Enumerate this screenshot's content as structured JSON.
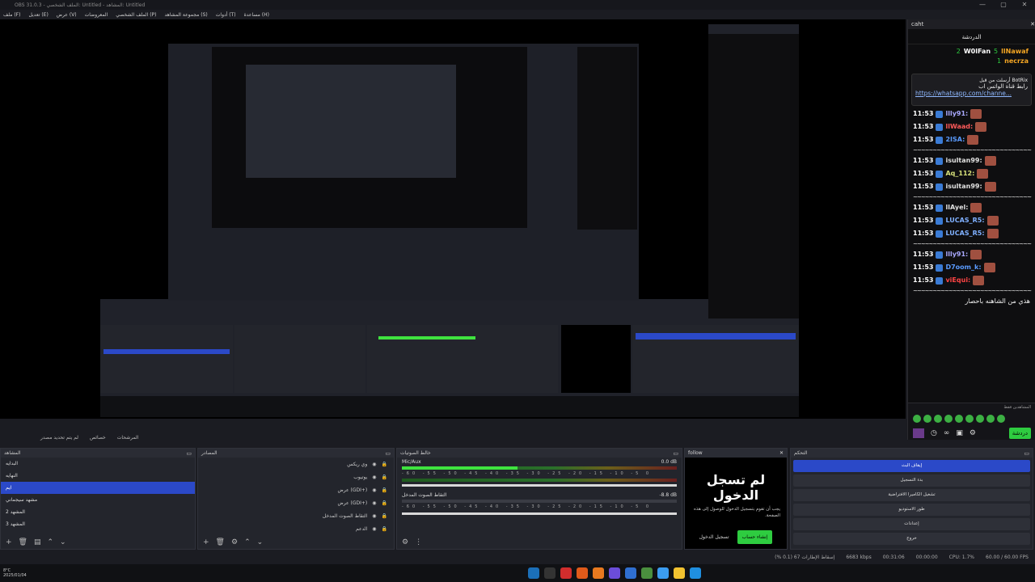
{
  "window": {
    "title": "OBS 31.0.3 - الملف الشخصي: Untitled - المشاهد: Untitled",
    "controls": [
      "—",
      "▢",
      "✕"
    ]
  },
  "menu": [
    "ملف (F)",
    "تعديل (E)",
    "عرض (V)",
    "المعروضات",
    "الملف الشخصي (P)",
    "مجموعة المشاهد (S)",
    "أدوات (T)",
    "مساعدة (H)"
  ],
  "chat": {
    "header": "caht",
    "title": "الدردشة",
    "leaders": [
      {
        "name": "llNawaf",
        "count": "5"
      },
      {
        "name": "W0lFan",
        "count": "2"
      },
      {
        "name": "necrza",
        "count": "1"
      }
    ],
    "pinned_by": "أرسلت من قبل BotRix",
    "pinned_text": "رابط قناة الواتس اب",
    "pinned_link": "https://whatsapp.com/channe...",
    "messages": [
      {
        "time": "11:53",
        "user": "llly91:",
        "color": "#a9a9ff"
      },
      {
        "time": "11:53",
        "user": "llWaad:",
        "color": "#ff5a5a"
      },
      {
        "time": "11:53",
        "user": "2ISA:",
        "color": "#5a9bff"
      },
      {
        "time": "11:53",
        "user": "isultan99:",
        "color": "#e0e0e0"
      },
      {
        "time": "11:53",
        "user": "Aq_112:",
        "color": "#d6e07a"
      },
      {
        "time": "11:53",
        "user": "isultan99:",
        "color": "#e0e0e0"
      },
      {
        "time": "11:53",
        "user": "llAyel:",
        "color": "#e0e0e0"
      },
      {
        "time": "11:53",
        "user": "LUCAS_R5:",
        "color": "#7fb0ff"
      },
      {
        "time": "11:53",
        "user": "LUCAS_R5:",
        "color": "#7fb0ff"
      },
      {
        "time": "11:53",
        "user": "llly91:",
        "color": "#a9a9ff"
      },
      {
        "time": "11:53",
        "user": "D7oom_k:",
        "color": "#5a9bff"
      },
      {
        "time": "11:53",
        "user": "viEqui:",
        "color": "#ff4444"
      }
    ],
    "tilde": "~~~~~~~~~~~~~~~~~~~~~~~~~~~~~~",
    "last_text": "هذي من الشاهنه باحصار",
    "watching": "المشاهدين فقط",
    "send_label": "دردشة"
  },
  "mode_bar": {
    "left": "لم يتم تحديد مصدر",
    "properties": "خصائص",
    "filters": "المرشحات"
  },
  "scenes": {
    "title": "المشاهد",
    "items": [
      "البدايه",
      "النهايه",
      "ايم",
      "مشهد سيجماني",
      "المشهد 2",
      "المشهد 3"
    ],
    "selected": 2
  },
  "sources": {
    "title": "المصادر",
    "items": [
      "وي ريكس",
      "يوتيوب",
      "عرض (GDI+)",
      "عرض (GDI+)",
      "التقاط الصوت المدخل",
      "الدعم"
    ]
  },
  "mixer": {
    "title": "خالط الصوتيات",
    "channels": [
      {
        "name": "Mic/Aux",
        "db": "0.0 dB",
        "level": 0.42
      },
      {
        "name": "التقاط الصوت المدخل",
        "db": "-8.8 dB",
        "level": 0.0
      }
    ],
    "ticks": "-60 -55 -50 -45 -40 -35 -30 -25 -20 -15 -10 -5 0"
  },
  "follow": {
    "title": "follow",
    "heading": "لم تسجل الدخول",
    "body": "يجب أن تقوم بتسجيل الدخول للوصول إلى هذه الصفحة.",
    "login": "تسجيل الدخول",
    "create": "إنشاء حساب"
  },
  "controls": {
    "title": "التحكم",
    "buttons": [
      "إيقاف البث",
      "بدء التسجيل",
      "تشغيل الكاميرا الافتراضية",
      "طور الاستوديو",
      "إعدادات",
      "خروج"
    ]
  },
  "status": {
    "fps": "60.00 / 60.00 FPS",
    "cpu": "CPU: 1.7%",
    "rec": "00:00:00",
    "stream": "00:31:06",
    "kbps": "6683 kbps",
    "dropped": "إسقاط الإطارات 67 (0.1 %)"
  },
  "taskbar": {
    "temp": "8°C",
    "date": "2025/01/04"
  },
  "colors": {
    "accent": "#2b49c8",
    "green": "#2ecc40",
    "panel": "#23252c"
  }
}
